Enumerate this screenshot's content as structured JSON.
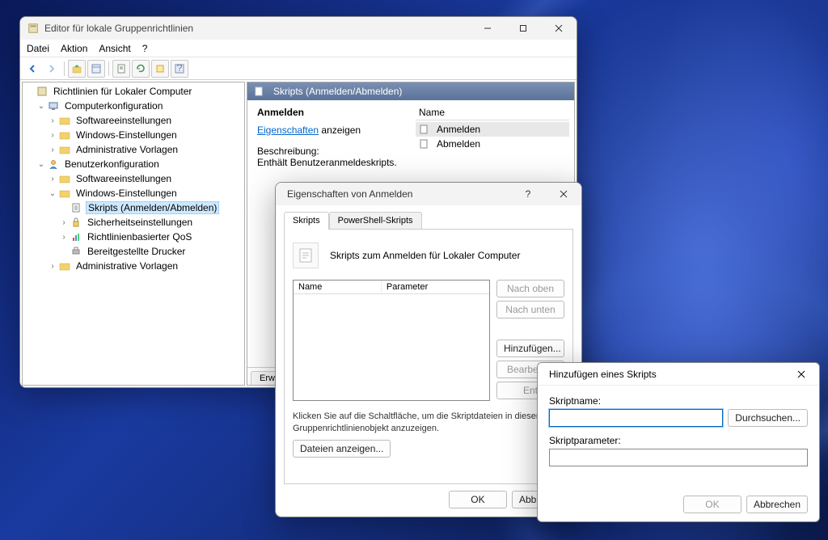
{
  "gpedit": {
    "title": "Editor für lokale Gruppenrichtlinien",
    "menu": {
      "file": "Datei",
      "action": "Aktion",
      "view": "Ansicht",
      "help": "?"
    },
    "tree": {
      "root": "Richtlinien für Lokaler Computer",
      "computer_cfg": "Computerkonfiguration",
      "cc_soft": "Softwareeinstellungen",
      "cc_win": "Windows-Einstellungen",
      "cc_admin": "Administrative Vorlagen",
      "user_cfg": "Benutzerkonfiguration",
      "uc_soft": "Softwareeinstellungen",
      "uc_win": "Windows-Einstellungen",
      "uc_scripts": "Skripts (Anmelden/Abmelden)",
      "uc_security": "Sicherheitseinstellungen",
      "uc_qos": "Richtlinienbasierter QoS",
      "uc_printers": "Bereitgestellte Drucker",
      "uc_admin": "Administrative Vorlagen"
    },
    "content": {
      "header": "Skripts (Anmelden/Abmelden)",
      "item_title": "Anmelden",
      "props_link": "Eigenschaften",
      "props_suffix": " anzeigen",
      "desc_label": "Beschreibung:",
      "desc_text": "Enthält Benutzeranmeldeskripts.",
      "name_col": "Name",
      "rows": [
        "Anmelden",
        "Abmelden"
      ],
      "tab": "Erweite"
    }
  },
  "props": {
    "title": "Eigenschaften von Anmelden",
    "tabs": {
      "scripts": "Skripts",
      "ps": "PowerShell-Skripts"
    },
    "info": "Skripts zum Anmelden für Lokaler Computer",
    "cols": {
      "name": "Name",
      "param": "Parameter"
    },
    "btns": {
      "up": "Nach oben",
      "down": "Nach unten",
      "add": "Hinzufügen...",
      "edit": "Bearbeiten",
      "ent": "Ent"
    },
    "hint": "Klicken Sie auf die Schaltfläche, um die Skriptdateien in diesem Gruppenrichtlinienobjekt anzuzeigen.",
    "show_files": "Dateien anzeigen...",
    "ok": "OK",
    "cancel": "Abbrechen"
  },
  "add": {
    "title": "Hinzufügen eines Skripts",
    "name_label": "Skriptname:",
    "param_label": "Skriptparameter:",
    "browse": "Durchsuchen...",
    "ok": "OK",
    "cancel": "Abbrechen",
    "name_value": "",
    "param_value": ""
  }
}
